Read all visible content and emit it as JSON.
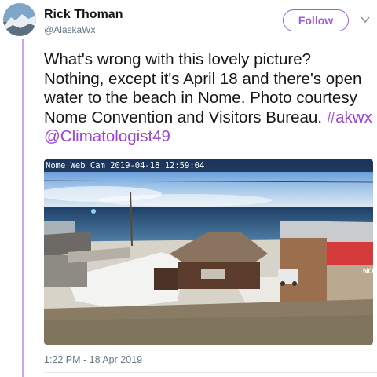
{
  "author": {
    "name": "Rick Thoman",
    "handle": "@AlaskaWx"
  },
  "actions": {
    "follow_label": "Follow"
  },
  "tweet": {
    "text_plain": "What's wrong with this lovely picture? Nothing, except it's April 18 and there's open water to the beach in Nome. Photo courtesy Nome Convention and Visitors Bureau.",
    "hashtag": "#akwx",
    "mention": "@Climatologist49"
  },
  "photo": {
    "cam_overlay": "Nome Web Cam 2019-04-18 12:59:04",
    "storefront_sign": "NO"
  },
  "meta": {
    "timestamp": "1:22 PM - 18 Apr 2019"
  },
  "colors": {
    "accent": "#9b5de5",
    "thread_line": "#c6a8ea"
  },
  "icons": {
    "avatar": "mountain-landscape-avatar",
    "menu": "chevron-down-icon"
  }
}
